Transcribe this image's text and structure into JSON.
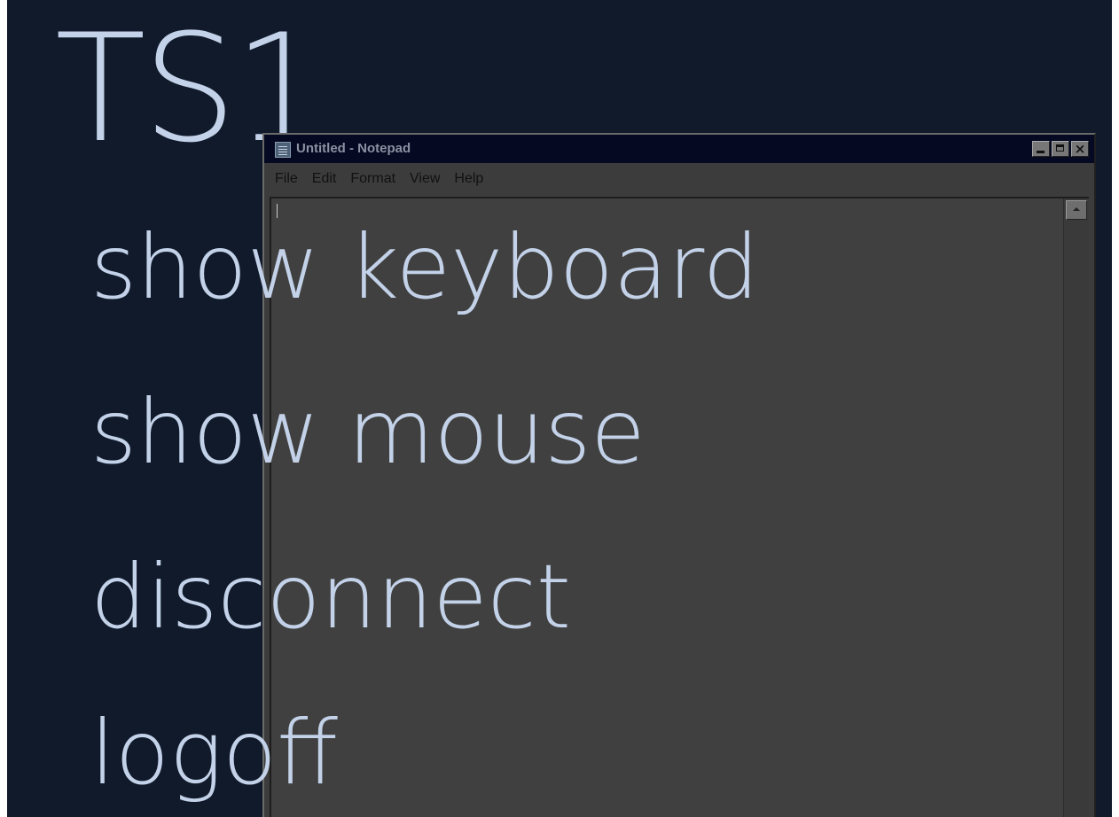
{
  "session": {
    "title": "TS1"
  },
  "notepad": {
    "window_title": "Untitled - Notepad",
    "menu": [
      "File",
      "Edit",
      "Format",
      "View",
      "Help"
    ],
    "icon": "notepad-icon"
  },
  "menu_options": [
    {
      "label": "show keyboard"
    },
    {
      "label": "show mouse"
    },
    {
      "label": "disconnect"
    },
    {
      "label": "logoff"
    }
  ],
  "colors": {
    "background": "#101a2b",
    "text": "#c3d2e8",
    "notepad_titlebar": "#050a22",
    "notepad_body": "#3c3c3c"
  }
}
